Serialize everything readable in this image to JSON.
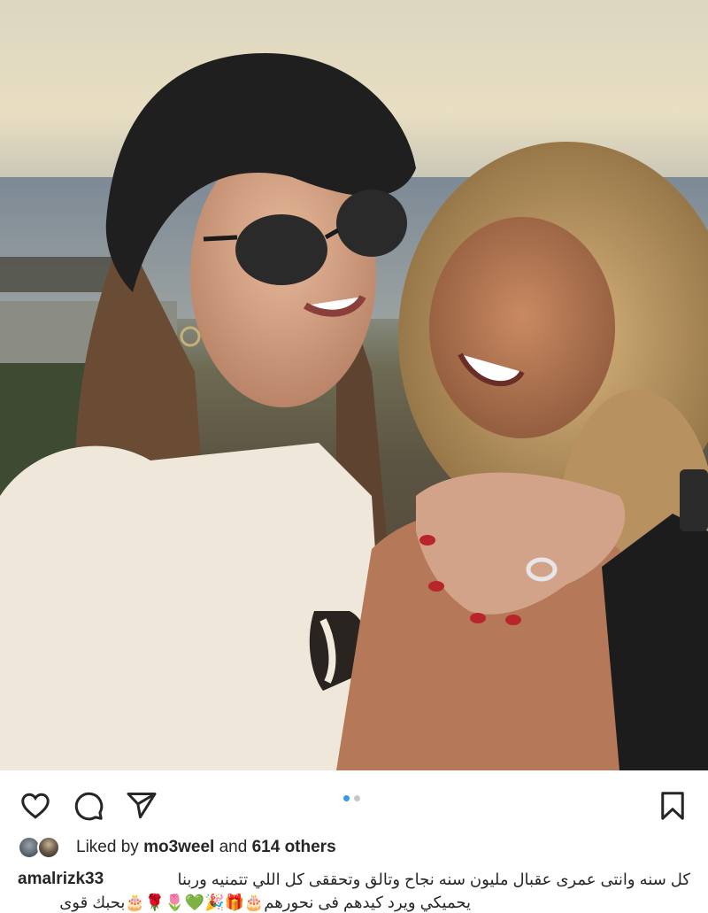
{
  "post": {
    "image_alt": "Two women smiling by the sea at sunset",
    "carousel": {
      "count": 2,
      "active_index": 0
    }
  },
  "actions": {
    "like_icon": "heart-icon",
    "comment_icon": "comment-icon",
    "share_icon": "paper-plane-icon",
    "save_icon": "bookmark-icon"
  },
  "likes": {
    "prefix": "Liked by",
    "user": "mo3weel",
    "connector": "and",
    "others": "614 others"
  },
  "caption": {
    "username": "amalrizk33",
    "line1": "كل سنه وانتى عمرى عقبال مليون سنه نجاح وتالق وتحققى كل اللي تتمنيه وربنا",
    "line2": "يحميكي ويرد كيدهم فى نحورهم🎂🎁🎉💚🌷🌹🎂بحبك قوى"
  },
  "colors": {
    "accent_dot": "#3897f0",
    "inactive_dot": "#c7c7c7",
    "text": "#262626"
  }
}
